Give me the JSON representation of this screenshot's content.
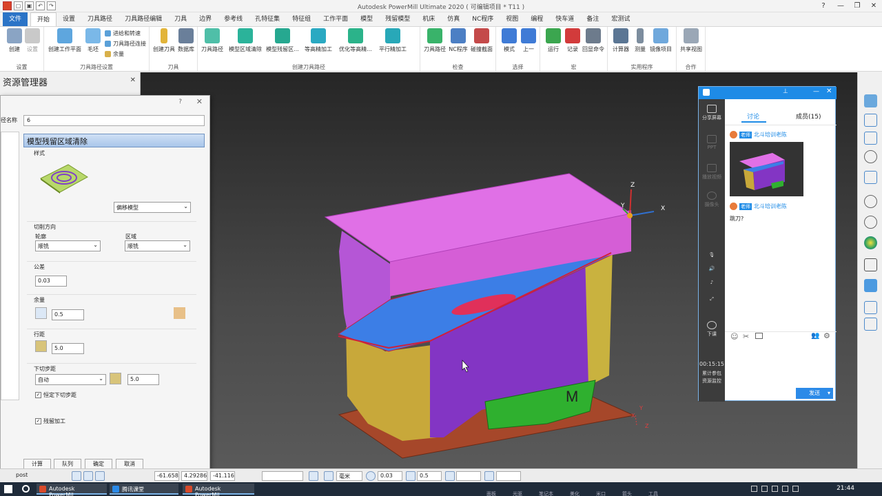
{
  "app": {
    "title": "Autodesk PowerMill Ultimate 2020   ( 可编辑项目 * T11 )",
    "file_tab": "文件",
    "tabs": [
      "开始",
      "设置",
      "刀具路径",
      "刀具路径编辑",
      "刀具",
      "边界",
      "参考线",
      "孔特征集",
      "特征组",
      "工作平面",
      "模型",
      "残留模型",
      "机床",
      "仿真",
      "NC程序",
      "视图",
      "编程",
      "快车道",
      "备注",
      "宏测试"
    ],
    "help_icon": "help-icon"
  },
  "ribbon": {
    "groups": {
      "setup": {
        "label": "设置",
        "buttons": [
          "创建",
          "设置"
        ]
      },
      "toolpath_setup": {
        "label": "刀具路径设置",
        "buttons": [
          "创建工作平面",
          "毛坯"
        ],
        "small": [
          "进给和转速",
          "刀具路径连接",
          "余量"
        ]
      },
      "tool": {
        "label": "刀具",
        "buttons": [
          "创建刀具",
          "数据库"
        ]
      },
      "create_toolpath": {
        "label": "创建刀具路径",
        "buttons": [
          "刀具路径",
          "模型区域清除",
          "模型残留区...",
          "等高精加工",
          "优化等高精...",
          "平行精加工"
        ]
      },
      "verify": {
        "label": "检查",
        "buttons": [
          "刀具路径",
          "NC程序",
          "碰撞截面"
        ]
      },
      "select": {
        "label": "选择",
        "buttons": [
          "模式",
          "上一"
        ]
      },
      "macro": {
        "label": "宏",
        "buttons": [
          "运行",
          "记录",
          "回显命令"
        ]
      },
      "utilities": {
        "label": "实用程序",
        "buttons": [
          "计算器",
          "测量",
          "镜像项目"
        ]
      },
      "collab": {
        "label": "合作",
        "buttons": [
          "共享视图"
        ]
      }
    }
  },
  "explorer": {
    "title": "资源管理器"
  },
  "dialog": {
    "help": "?",
    "name_label": "径名称",
    "name_value": "6",
    "strategy_title": "模型残留区域清除",
    "style_label": "样式",
    "style_value": "偏移模型",
    "cut_direction_label": "切削方向",
    "profile_label": "轮廓",
    "profile_value": "顺铣",
    "area_label": "区域",
    "area_value": "顺铣",
    "tolerance_label": "公差",
    "tolerance_value": "0.03",
    "thickness_label": "余量",
    "thickness_value": "0.5",
    "stepover_label": "行距",
    "stepover_value": "5.0",
    "stepdown_label": "下切步距",
    "stepdown_mode": "自动",
    "stepdown_value": "5.0",
    "constant_stepdown_label": "恒定下切步距",
    "constant_stepdown_checked": true,
    "rest_machining_label": "残留加工",
    "rest_machining_checked": true,
    "buttons": {
      "calculate": "计算",
      "queue": "队列",
      "ok": "确定",
      "cancel": "取消"
    }
  },
  "viewport": {
    "axis_x": "X",
    "axis_y": "Y",
    "axis_z": "Z",
    "axis_x2": "X",
    "axis_y2": "Y",
    "axis_z2": "Z",
    "model_letter": "M"
  },
  "chat": {
    "tab_discuss": "讨论",
    "tab_members": "成员(15)",
    "side": [
      "分享屏幕",
      "PPT",
      "播放视频",
      "摄像头"
    ],
    "end_class": "下课",
    "timer": "00:15:15",
    "accumulated": "累计参包",
    "resource": "资源监控",
    "messages": [
      {
        "badge": "老师",
        "sender": "北斗培训老陈",
        "text": ""
      },
      {
        "badge": "老师",
        "sender": "北斗培训老陈",
        "text": "跳刀?"
      }
    ],
    "send": "发送"
  },
  "statusbar": {
    "workplane": "post",
    "coord_x": "-61.658",
    "coord_y": "4.29286",
    "coord_z": "-41.116",
    "units": "毫米",
    "tolerance": "0.03",
    "thickness": "0.5"
  },
  "taskbar": {
    "apps": [
      "Autodesk PowerMil...",
      "腾讯课堂",
      "Autodesk PowerMil..."
    ],
    "tray": [
      "面板",
      "光驱",
      "笔记本",
      "美化",
      "米口",
      "箭头",
      "工具"
    ],
    "time": "21:44"
  },
  "colors": {
    "ribbon_file_tab": "#2b74c7",
    "viewport_bg": "#333333",
    "model_magenta": "#e060e0",
    "model_blue": "#3a7ee8",
    "model_purple": "#8a3ac8",
    "model_yellow": "#c8b038",
    "model_green": "#30b030",
    "model_base": "#a04a28",
    "chat_header": "#1e8be6"
  }
}
